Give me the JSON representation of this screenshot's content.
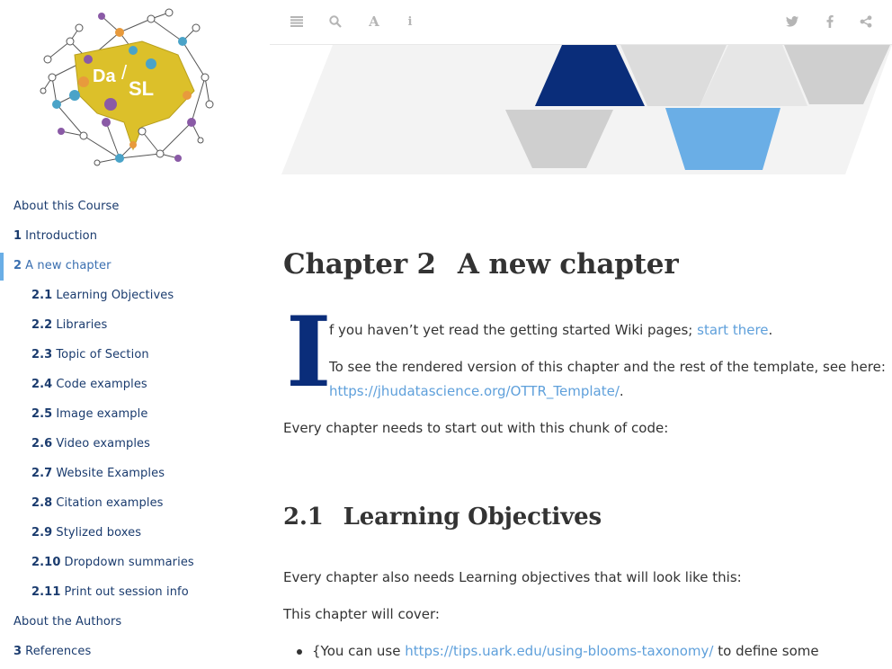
{
  "sidebar": {
    "logo_text_top": "Da",
    "logo_text_bottom": "SL",
    "items": [
      {
        "num": "",
        "label": "About this Course",
        "level": 0,
        "active": false
      },
      {
        "num": "1",
        "label": "Introduction",
        "level": 0,
        "active": false
      },
      {
        "num": "2",
        "label": "A new chapter",
        "level": 0,
        "active": true
      },
      {
        "num": "2.1",
        "label": "Learning Objectives",
        "level": 1,
        "active": false
      },
      {
        "num": "2.2",
        "label": "Libraries",
        "level": 1,
        "active": false
      },
      {
        "num": "2.3",
        "label": "Topic of Section",
        "level": 1,
        "active": false
      },
      {
        "num": "2.4",
        "label": "Code examples",
        "level": 1,
        "active": false
      },
      {
        "num": "2.5",
        "label": "Image example",
        "level": 1,
        "active": false
      },
      {
        "num": "2.6",
        "label": "Video examples",
        "level": 1,
        "active": false
      },
      {
        "num": "2.7",
        "label": "Website Examples",
        "level": 1,
        "active": false
      },
      {
        "num": "2.8",
        "label": "Citation examples",
        "level": 1,
        "active": false
      },
      {
        "num": "2.9",
        "label": "Stylized boxes",
        "level": 1,
        "active": false
      },
      {
        "num": "2.10",
        "label": "Dropdown summaries",
        "level": 1,
        "active": false
      },
      {
        "num": "2.11",
        "label": "Print out session info",
        "level": 1,
        "active": false
      },
      {
        "num": "",
        "label": "About the Authors",
        "level": 0,
        "active": false
      },
      {
        "num": "3",
        "label": "References",
        "level": 0,
        "active": false
      }
    ]
  },
  "toolbar": {
    "left_icons": [
      "toc-toggle-icon",
      "search-icon",
      "font-settings-icon",
      "info-icon"
    ],
    "right_icons": [
      "twitter-icon",
      "facebook-icon",
      "share-icon"
    ]
  },
  "content": {
    "chapter_number": "Chapter 2",
    "chapter_title": "A new chapter",
    "drop_cap": "I",
    "p1_text": "f you haven’t yet read the getting started Wiki pages; ",
    "p1_link": "start there",
    "p1_end": ".",
    "p2_text": "To see the rendered version of this chapter and the rest of the template, see here:",
    "p2_link": "https://jhudatascience.org/OTTR_Template/",
    "p2_end": ".",
    "p3_text": "Every chapter needs to start out with this chunk of code:",
    "section_number": "2.1",
    "section_title": "Learning Objectives",
    "p4_text": "Every chapter also needs Learning objectives that will look like this:",
    "p5_text": "This chapter will cover:",
    "bullet_prefix": "{You can use ",
    "bullet_link": "https://tips.uark.edu/using-blooms-taxonomy/",
    "bullet_suffix": " to define some"
  },
  "colors": {
    "accent_link": "#5fa0db",
    "navy": "#0a2d7a",
    "toc_text": "#1a3b6e",
    "active_bar": "#6aaee6",
    "logo_yellow": "#dcc02a"
  }
}
